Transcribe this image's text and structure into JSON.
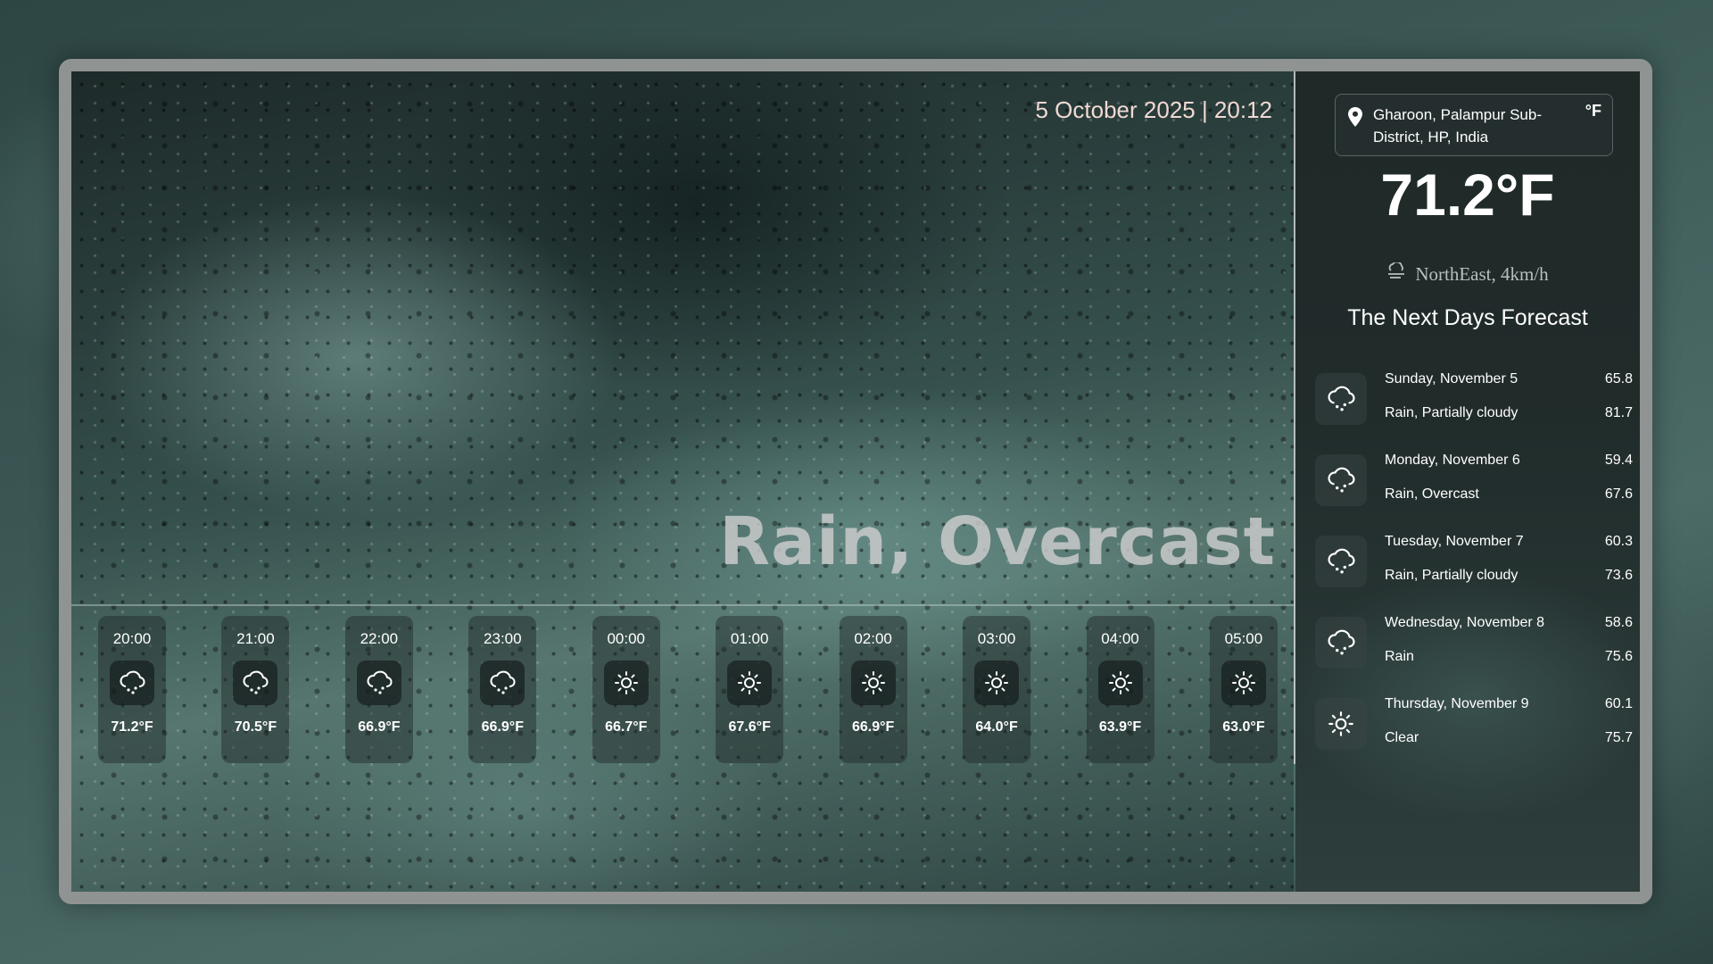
{
  "header": {
    "date_time": "5 October 2025 | 20:12"
  },
  "current": {
    "condition": "Rain, Overcast",
    "temperature": "71.2°F",
    "wind": "NorthEast, 4km/h",
    "unit_toggle": "°F"
  },
  "location": {
    "name": "Gharoon, Palampur Sub-District, HP, India"
  },
  "hourly": [
    {
      "time": "20:00",
      "icon": "rain-cloud-icon",
      "temp": "71.2°F"
    },
    {
      "time": "21:00",
      "icon": "rain-cloud-icon",
      "temp": "70.5°F"
    },
    {
      "time": "22:00",
      "icon": "rain-cloud-icon",
      "temp": "66.9°F"
    },
    {
      "time": "23:00",
      "icon": "rain-cloud-icon",
      "temp": "66.9°F"
    },
    {
      "time": "00:00",
      "icon": "sun-icon",
      "temp": "66.7°F"
    },
    {
      "time": "01:00",
      "icon": "sun-icon",
      "temp": "67.6°F"
    },
    {
      "time": "02:00",
      "icon": "sun-icon",
      "temp": "66.9°F"
    },
    {
      "time": "03:00",
      "icon": "sun-icon",
      "temp": "64.0°F"
    },
    {
      "time": "04:00",
      "icon": "sun-icon",
      "temp": "63.9°F"
    },
    {
      "time": "05:00",
      "icon": "sun-icon",
      "temp": "63.0°F"
    }
  ],
  "forecast": {
    "title": "The Next Days Forecast",
    "days": [
      {
        "day": "Sunday, November 5",
        "condition": "Rain, Partially cloudy",
        "min": "65.8",
        "max": "81.7",
        "icon": "rain-cloud-icon"
      },
      {
        "day": "Monday, November 6",
        "condition": "Rain, Overcast",
        "min": "59.4",
        "max": "67.6",
        "icon": "rain-cloud-icon"
      },
      {
        "day": "Tuesday, November 7",
        "condition": "Rain, Partially cloudy",
        "min": "60.3",
        "max": "73.6",
        "icon": "rain-cloud-icon"
      },
      {
        "day": "Wednesday, November 8",
        "condition": "Rain",
        "min": "58.6",
        "max": "75.6",
        "icon": "rain-cloud-icon"
      },
      {
        "day": "Thursday, November 9",
        "condition": "Clear",
        "min": "60.1",
        "max": "75.7",
        "icon": "sun-icon"
      }
    ]
  }
}
